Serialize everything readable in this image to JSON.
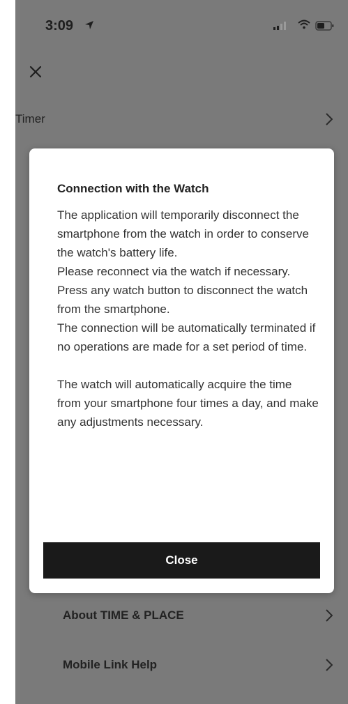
{
  "status_bar": {
    "time": "3:09"
  },
  "settings": {
    "items": [
      {
        "label": "Timer"
      },
      {
        "label": "About TIME & PLACE"
      },
      {
        "label": "Mobile Link Help"
      }
    ]
  },
  "dialog": {
    "title": "Connection with the Watch",
    "body_lines": [
      "The application will temporarily disconnect the smartphone from the watch in order to conserve the watch's battery life.",
      "Please reconnect via the watch if necessary.",
      "Press any watch button to disconnect the watch from the smartphone.",
      "The connection will be automatically terminated if no operations are made for a set period of time.",
      "The watch will automatically acquire the time from your smartphone four times a day, and make any adjustments necessary."
    ],
    "close_label": "Close"
  }
}
